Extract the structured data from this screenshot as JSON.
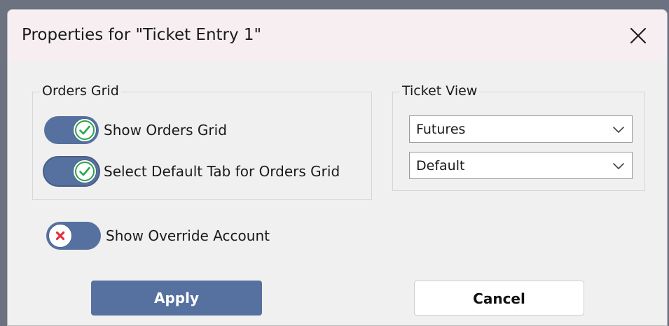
{
  "dialog": {
    "title": "Properties for \"Ticket Entry 1\""
  },
  "orders_grid": {
    "legend": "Orders Grid",
    "show_orders_grid": {
      "label": "Show Orders Grid",
      "checked": true
    },
    "select_default_tab": {
      "label": "Select Default Tab for Orders Grid",
      "checked": true
    }
  },
  "ticket_view": {
    "legend": "Ticket View",
    "instrument": {
      "selected": "Futures"
    },
    "layout": {
      "selected": "Default"
    }
  },
  "show_override_account": {
    "label": "Show Override Account",
    "checked": false
  },
  "buttons": {
    "apply": "Apply",
    "cancel": "Cancel"
  },
  "colors": {
    "accent": "#5671a0",
    "check": "#2aa548",
    "cross": "#e0323c",
    "title_bar": "#f7eef1",
    "dialog_bg": "#f0f0f0"
  },
  "icons": {
    "close": "close-icon",
    "check": "check-icon",
    "cross": "cross-icon",
    "dropdown": "chevron-down-icon"
  }
}
